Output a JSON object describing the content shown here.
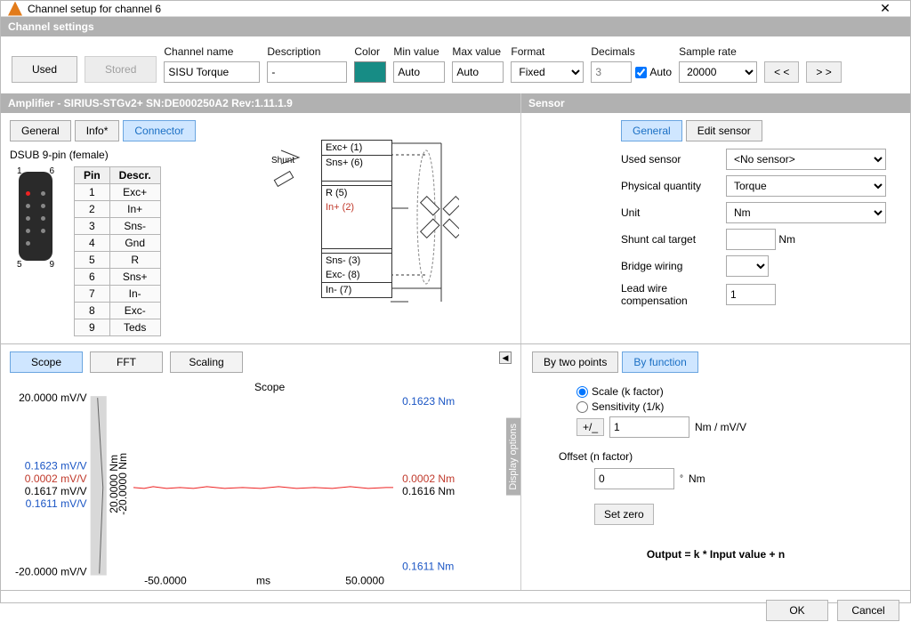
{
  "window": {
    "title": "Channel setup for channel 6"
  },
  "header": {
    "settings": "Channel settings"
  },
  "top": {
    "used": "Used",
    "stored": "Stored",
    "channel_name_lbl": "Channel name",
    "channel_name": "SISU Torque",
    "description_lbl": "Description",
    "description": "-",
    "color_lbl": "Color",
    "min_lbl": "Min value",
    "min": "Auto",
    "max_lbl": "Max value",
    "max": "Auto",
    "format_lbl": "Format",
    "format": "Fixed",
    "decimals_lbl": "Decimals",
    "decimals": "3",
    "auto": "Auto",
    "sample_lbl": "Sample rate",
    "sample": "20000",
    "prev": "< <",
    "next": "> >"
  },
  "amp": {
    "title": "Amplifier - SIRIUS-STGv2+  SN:DE000250A2 Rev:1.11.1.9",
    "tabs": {
      "general": "General",
      "info": "Info*",
      "connector": "Connector"
    },
    "dsub": "DSUB 9-pin (female)",
    "pin_hdr": {
      "pin": "Pin",
      "descr": "Descr."
    },
    "pins": [
      {
        "n": "1",
        "d": "Exc+"
      },
      {
        "n": "2",
        "d": "In+"
      },
      {
        "n": "3",
        "d": "Sns-"
      },
      {
        "n": "4",
        "d": "Gnd"
      },
      {
        "n": "5",
        "d": "R"
      },
      {
        "n": "6",
        "d": "Sns+"
      },
      {
        "n": "7",
        "d": "In-"
      },
      {
        "n": "8",
        "d": "Exc-"
      },
      {
        "n": "9",
        "d": "Teds"
      }
    ],
    "conn_n": {
      "1": "1",
      "6": "6",
      "5": "5",
      "9": "9"
    },
    "schem": {
      "excp": "Exc+ (1)",
      "snsp": "Sns+ (6)",
      "r": "R (5)",
      "inp": "In+ (2)",
      "snsm": "Sns- (3)",
      "excm": "Exc- (8)",
      "inm": "In- (7)",
      "shunt": "Shunt"
    }
  },
  "sensor": {
    "title": "Sensor",
    "tabs": {
      "general": "General",
      "edit": "Edit sensor"
    },
    "used_lbl": "Used sensor",
    "used": "<No sensor>",
    "pq_lbl": "Physical quantity",
    "pq": "Torque",
    "unit_lbl": "Unit",
    "unit": "Nm",
    "shunt_lbl": "Shunt cal target",
    "shunt": "",
    "shunt_u": "Nm",
    "bridge_lbl": "Bridge wiring",
    "bridge": "",
    "lead_lbl": "Lead wire compensation",
    "lead": "1"
  },
  "scope": {
    "tabs": {
      "scope": "Scope",
      "fft": "FFT",
      "scaling": "Scaling"
    },
    "chev": "◀",
    "title": "Scope",
    "disp": "Display options",
    "yleft_top": "20.0000 mV/V",
    "yleft_bot": "-20.0000 mV/V",
    "mid1": "0.1623 mV/V",
    "mid2": "0.0002 mV/V",
    "mid3": "0.1617 mV/V",
    "mid4": "0.1611 mV/V",
    "yleft_unit": "20.0000 Nm",
    "yleft_unit_neg": "-20.0000 Nm",
    "yr_top": "0.1623 Nm",
    "yr_mid": "0.0002 Nm",
    "yr_mid2": "0.1616 Nm",
    "yr_bot": "0.1611 Nm",
    "x_left": "-50.0000",
    "x_right": "50.0000",
    "x_unit": "ms"
  },
  "chart_data": {
    "type": "line",
    "title": "Scope",
    "xlabel": "ms",
    "x_range": [
      -50,
      50
    ],
    "ylabel_left": "mV/V",
    "y_range_left": [
      -20,
      20
    ],
    "ylabel_right": "Nm",
    "y_range_right": [
      -20,
      20
    ],
    "series": [
      {
        "name": "Torque",
        "mean_mV_V": 0.1617,
        "mean_Nm": 0.1616,
        "std_mV_V": 0.0002,
        "max_mV_V": 0.1623,
        "min_mV_V": 0.1611
      }
    ]
  },
  "scaling": {
    "tabs": {
      "two": "By two points",
      "fn": "By function"
    },
    "scale_r": "Scale (k factor)",
    "sens_r": "Sensitivity (1/k)",
    "pm": "+/_",
    "k": "1",
    "k_unit": "Nm / mV/V",
    "off_lbl": "Offset (n factor)",
    "off": "0",
    "off_u": "Nm",
    "off_deg": "°",
    "setzero": "Set zero",
    "formula": "Output = k * Input value + n"
  },
  "footer": {
    "ok": "OK",
    "cancel": "Cancel"
  }
}
